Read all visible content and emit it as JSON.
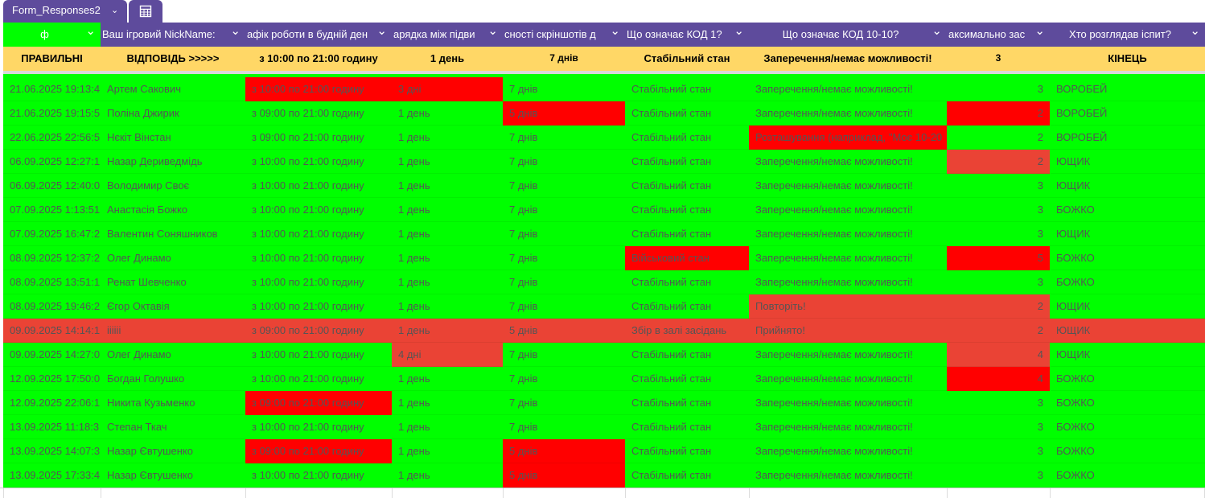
{
  "sheet": {
    "tab_name": "Form_Responses2",
    "tab_chevron": "⌄"
  },
  "colors": {
    "green": "#00ff00",
    "red": "#ff0000",
    "soft_red": "#ea4335",
    "header": "#5e4b9c",
    "answers": "#ffd766"
  },
  "headers": [
    {
      "label": "ф"
    },
    {
      "label": "Ваш ігровий NickName:"
    },
    {
      "label": "афік роботи в будній ден"
    },
    {
      "label": "арядка між підви"
    },
    {
      "label": "сності скріншотів д"
    },
    {
      "label": "Що означає КОД 1?"
    },
    {
      "label": "Що означає КОД 10-10?"
    },
    {
      "label": "аксимально зас"
    },
    {
      "label": "Хто розглядав іспит?"
    }
  ],
  "answers": [
    "ПРАВИЛЬНІ",
    "ВІДПОВІДЬ >>>>>",
    "з 10:00 по 21:00 годину",
    "1 день",
    "7 днів",
    "Стабільний стан",
    "Заперечення/немає можливості!",
    "3",
    "КІНЕЦЬ"
  ],
  "rows": [
    {
      "cells": [
        "21.06.2025 19:13:4",
        "Артем Сакович",
        "з 10:00 по 21:00 годину",
        "3 дні",
        "7 днів",
        "Стабільний стан",
        "Заперечення/немає можливості!",
        "3",
        "ВОРОБЕЙ"
      ],
      "fills": [
        "g",
        "g",
        "r",
        "r",
        "g",
        "g",
        "g",
        "g",
        "g"
      ]
    },
    {
      "cells": [
        "21.06.2025 19:15:5",
        "Поліна Джирик",
        "з 09:00 по 21:00 годину",
        "1 день",
        "5 днів",
        "Стабільний стан",
        "Заперечення/немає можливості!",
        "2",
        "ВОРОБЕЙ"
      ],
      "fills": [
        "g",
        "g",
        "g",
        "g",
        "r",
        "g",
        "g",
        "r",
        "g"
      ]
    },
    {
      "cells": [
        "22.06.2025 22:56:5",
        "Нєкіт Вінстан",
        "з 09:00 по 21:00 годину",
        "1 день",
        "7 днів",
        "Стабільний стан",
        "Розташування (наприклад, \"Моє 10-20",
        "2",
        "ВОРОБЕЙ"
      ],
      "fills": [
        "g",
        "g",
        "g",
        "g",
        "g",
        "g",
        "r",
        "g",
        "g"
      ]
    },
    {
      "cells": [
        "06.09.2025 12:27:1",
        "Назар Дериведмідь",
        "з 10:00 по 21:00 годину",
        "1 день",
        "7 днів",
        "Стабільний стан",
        "Заперечення/немає можливості!",
        "2",
        "ЮЩИК"
      ],
      "fills": [
        "g",
        "g",
        "g",
        "g",
        "g",
        "g",
        "g",
        "s",
        "g"
      ]
    },
    {
      "cells": [
        "06.09.2025 12:40:0",
        "Володимир Своє",
        "з 10:00 по 21:00 годину",
        "1 день",
        "7 днів",
        "Стабільний стан",
        "Заперечення/немає можливості!",
        "3",
        "ЮЩИК"
      ],
      "fills": [
        "g",
        "g",
        "g",
        "g",
        "g",
        "g",
        "g",
        "g",
        "g"
      ]
    },
    {
      "cells": [
        "07.09.2025 1:13:51",
        "Анастасія Божко",
        "з 10:00 по 21:00 годину",
        "1 день",
        "7 днів",
        "Стабільний стан",
        "Заперечення/немає можливості!",
        "3",
        "БОЖКО"
      ],
      "fills": [
        "g",
        "g",
        "g",
        "g",
        "g",
        "g",
        "g",
        "g",
        "g"
      ]
    },
    {
      "cells": [
        "07.09.2025 16:47:2",
        "Валентин Соняшников",
        "з 10:00 по 21:00 годину",
        "1 день",
        "7 днів",
        "Стабільний стан",
        "Заперечення/немає можливості!",
        "3",
        "ЮЩИК"
      ],
      "fills": [
        "g",
        "g",
        "g",
        "g",
        "g",
        "g",
        "g",
        "g",
        "g"
      ]
    },
    {
      "cells": [
        "08.09.2025 12:37:2",
        "Олег Динамо",
        "з 10:00 по 21:00 годину",
        "1 день",
        "7 днів",
        "Військовий стан",
        "Заперечення/немає можливості!",
        "5",
        "БОЖКО"
      ],
      "fills": [
        "g",
        "g",
        "g",
        "g",
        "g",
        "r",
        "g",
        "r",
        "g"
      ]
    },
    {
      "cells": [
        "08.09.2025 13:51:1",
        "Ренат Шевченко",
        "з 10:00 по 21:00 годину",
        "1 день",
        "7 днів",
        "Стабільний стан",
        "Заперечення/немає можливості!",
        "3",
        "БОЖКО"
      ],
      "fills": [
        "g",
        "g",
        "g",
        "g",
        "g",
        "g",
        "g",
        "g",
        "g"
      ]
    },
    {
      "cells": [
        "08.09.2025 19:46:2",
        "Єгор Октавія",
        "з 10:00 по 21:00 годину",
        "1 день",
        "7 днів",
        "Стабільний стан",
        "Повторіть!",
        "2",
        "ЮЩИК"
      ],
      "fills": [
        "g",
        "g",
        "g",
        "g",
        "g",
        "g",
        "s",
        "s",
        "g"
      ]
    },
    {
      "cells": [
        "09.09.2025 14:14:1",
        "iiiiii",
        "з 09:00 по 21:00 годину",
        "1 день",
        "5 днів",
        "Збір в залі засідань",
        "Прийнято!",
        "2",
        "ЮЩИК"
      ],
      "fills": [
        "s",
        "s",
        "s",
        "s",
        "s",
        "s",
        "s",
        "s",
        "s"
      ]
    },
    {
      "cells": [
        "09.09.2025 14:27:0",
        "Олег Динамо",
        "з 10:00 по 21:00 годину",
        "4 дні",
        "7 днів",
        "Стабільний стан",
        "Заперечення/немає можливості!",
        "4",
        "ЮЩИК"
      ],
      "fills": [
        "g",
        "g",
        "g",
        "s",
        "g",
        "g",
        "g",
        "s",
        "g"
      ]
    },
    {
      "cells": [
        "12.09.2025 17:50:0",
        "Богдан Голушко",
        "з 10:00 по 21:00 годину",
        "1 день",
        "7 днів",
        "Стабільний стан",
        "Заперечення/немає можливості!",
        "4",
        "БОЖКО"
      ],
      "fills": [
        "g",
        "g",
        "g",
        "g",
        "g",
        "g",
        "g",
        "r",
        "g"
      ]
    },
    {
      "cells": [
        "12.09.2025 22:06:1",
        "Никита Кузьменко",
        "з 09:00 по 21:00 годину",
        "1 день",
        "7 днів",
        "Стабільний стан",
        "Заперечення/немає можливості!",
        "3",
        "БОЖКО"
      ],
      "fills": [
        "g",
        "g",
        "r",
        "g",
        "g",
        "g",
        "g",
        "g",
        "g"
      ]
    },
    {
      "cells": [
        "13.09.2025 11:18:3",
        "Степан Ткач",
        "з 10:00 по 21:00 годину",
        "1 день",
        "7 днів",
        "Стабільний стан",
        "Заперечення/немає можливості!",
        "3",
        "БОЖКО"
      ],
      "fills": [
        "g",
        "g",
        "g",
        "g",
        "g",
        "g",
        "g",
        "g",
        "g"
      ]
    },
    {
      "cells": [
        "13.09.2025 14:07:3",
        "Назар Євтушенко",
        "з 09:00 по 21:00 годину",
        "1 день",
        "5 днів",
        "Стабільний стан",
        "Заперечення/немає можливості!",
        "3",
        "БОЖКО"
      ],
      "fills": [
        "g",
        "g",
        "r",
        "g",
        "r",
        "g",
        "g",
        "g",
        "g"
      ]
    },
    {
      "cells": [
        "13.09.2025 17:33:4",
        "Назар Євтушенко",
        "з 10:00 по 21:00 годину",
        "1 день",
        "5 днів",
        "Стабільний стан",
        "Заперечення/немає можливості!",
        "3",
        "БОЖКО"
      ],
      "fills": [
        "g",
        "g",
        "g",
        "g",
        "r",
        "g",
        "g",
        "g",
        "g"
      ]
    }
  ]
}
